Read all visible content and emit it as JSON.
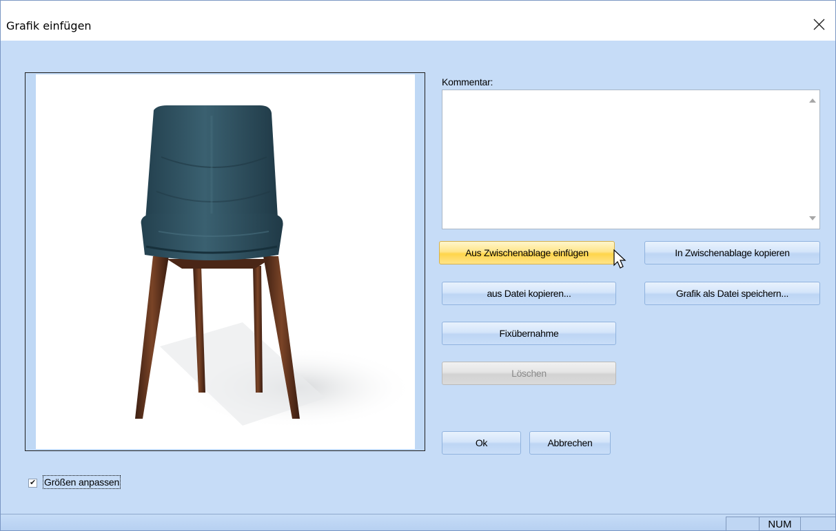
{
  "window": {
    "title": "Grafik einfügen"
  },
  "comment": {
    "label": "Kommentar:",
    "value": ""
  },
  "buttons": {
    "paste_clipboard": "Aus Zwischenablage einfügen",
    "copy_clipboard": "In Zwischenablage kopieren",
    "copy_from_file": "aus Datei kopieren...",
    "save_as_file": "Grafik als Datei speichern...",
    "fix_transfer": "Fixübernahme",
    "delete": "Löschen",
    "ok": "Ok",
    "cancel": "Abbrechen"
  },
  "fit_size": {
    "label": "Größen anpassen",
    "checked": true
  },
  "statusbar": {
    "num": "NUM"
  },
  "icons": {
    "close": "close-icon",
    "check": "checkmark-icon",
    "cursor": "mouse-pointer-icon"
  },
  "colors": {
    "dialog_bg": "#c6dcf7",
    "hot_button": "#ffd54a",
    "chair_seat": "#2f4f5f",
    "chair_legs": "#5a2f1b"
  }
}
